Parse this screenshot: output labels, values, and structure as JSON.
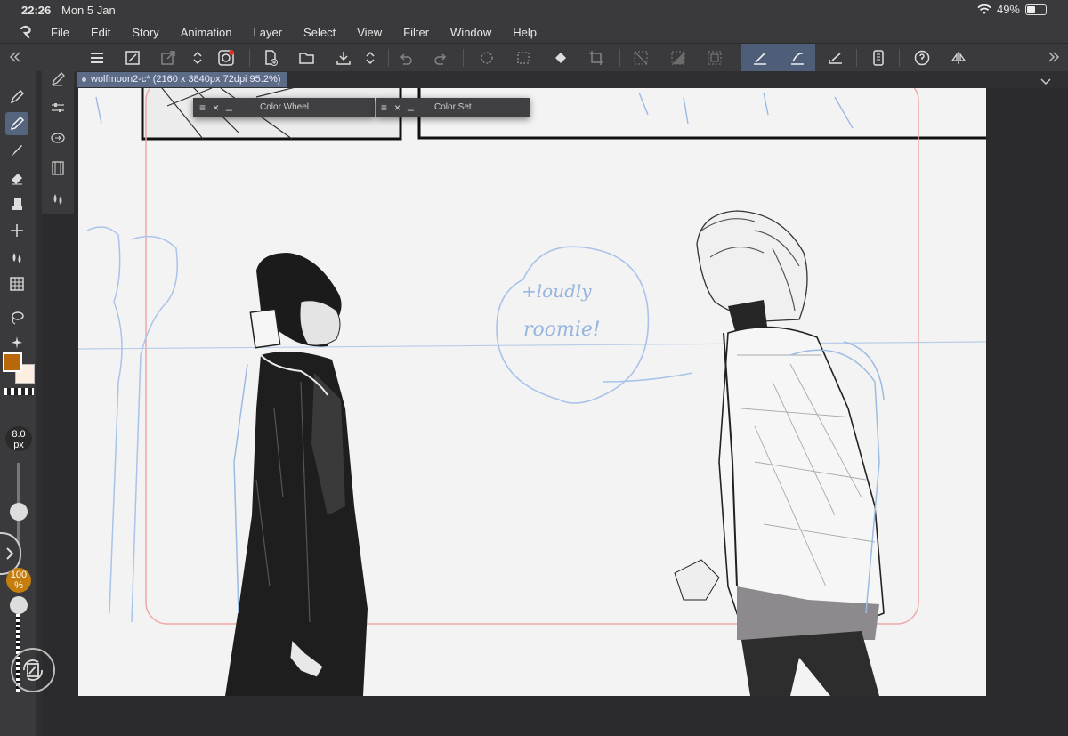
{
  "status": {
    "time": "22:26",
    "date": "Mon 5 Jan",
    "battery": "49%",
    "battery_level": 0.49
  },
  "menu": [
    "File",
    "Edit",
    "Story",
    "Animation",
    "Layer",
    "Select",
    "View",
    "Filter",
    "Window",
    "Help"
  ],
  "document": {
    "tab_label": "wolfmoon2-c* (2160 x 3840px 72dpi 95.2%)"
  },
  "palettes": {
    "color_wheel": "Color Wheel",
    "color_set": "Color Set"
  },
  "brush": {
    "size_value": "8.0",
    "size_unit": "px",
    "opacity_value": "100",
    "opacity_unit": "%"
  },
  "colors": {
    "main": "#b8680a",
    "sub": "#fdeee2",
    "accent": "#56657e",
    "opacity_badge": "#c57e0c"
  },
  "canvas_text": {
    "speech_line1": "+loudly",
    "speech_line2": "roomie!"
  }
}
